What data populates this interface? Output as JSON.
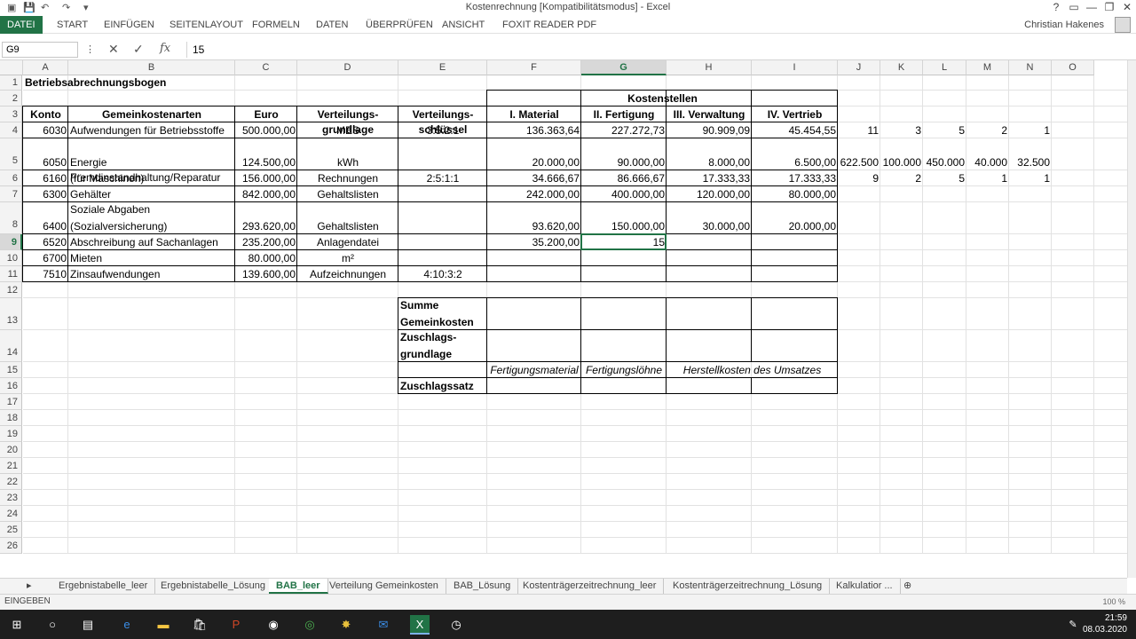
{
  "window": {
    "title": "Kostenrechnung  [Kompatibilitätsmodus] - Excel",
    "help": "?",
    "minimize": "—",
    "restore": "❐",
    "close": "✕"
  },
  "ribbon": {
    "tabs": [
      "DATEI",
      "START",
      "EINFÜGEN",
      "SEITENLAYOUT",
      "FORMELN",
      "DATEN",
      "ÜBERPRÜFEN",
      "ANSICHT",
      "FOXIT READER PDF"
    ],
    "user": "Christian Hakenes"
  },
  "formula_bar": {
    "name_box": "G9",
    "content": "15",
    "cancel_icon": "✕",
    "enter_icon": "✓",
    "fx_label": "fx"
  },
  "columns": [
    "A",
    "B",
    "C",
    "D",
    "E",
    "F",
    "G",
    "H",
    "I",
    "J",
    "K",
    "L",
    "M",
    "N",
    "O"
  ],
  "rows": [
    "1",
    "2",
    "3",
    "4",
    "5",
    "6",
    "7",
    "8",
    "9",
    "10",
    "11",
    "12",
    "13",
    "14",
    "15",
    "16",
    "17",
    "18",
    "19",
    "20",
    "21",
    "22",
    "23",
    "24",
    "25",
    "26"
  ],
  "sheet": {
    "title": "Betriebsabrechnungsbogen",
    "kostenstellen": "Kostenstellen",
    "headers": {
      "konto": "Konto",
      "arten": "Gemeinkostenarten",
      "euro": "Euro",
      "grundlage": "Verteilungs-\ngrundlage",
      "schluessel": "Verteilungs-\nschlüssel",
      "f": "I. Material",
      "g": "II. Fertigung",
      "h": "III. Verwaltung",
      "i": "IV. Vertrieb"
    },
    "r4": {
      "konto": "6030",
      "art": "Aufwendungen für Betriebsstoffe",
      "euro": "500.000,00",
      "grundlage": "MES",
      "schluessel": "3:5:2:1",
      "f": "136.363,64",
      "g": "227.272,73",
      "h": "90.909,09",
      "i": "45.454,55",
      "j": "11",
      "k": "3",
      "l": "5",
      "m": "2",
      "n": "1"
    },
    "r5": {
      "konto": "6050",
      "art": "Energie",
      "euro": "124.500,00",
      "grundlage": "kWh",
      "f": "20.000,00",
      "g": "90.000,00",
      "h": "8.000,00",
      "i": "6.500,00",
      "j": "622.500",
      "k": "100.000",
      "l": "450.000",
      "m": "40.000",
      "n": "32.500"
    },
    "r6": {
      "konto": "6160",
      "art1": "Fremdinstandhaltung/Reparatur",
      "art2": "(für Maschinen)",
      "euro": "156.000,00",
      "grundlage": "Rechnungen",
      "schluessel": "2:5:1:1",
      "f": "34.666,67",
      "g": "86.666,67",
      "h": "17.333,33",
      "i": "17.333,33",
      "j": "9",
      "k": "2",
      "l": "5",
      "m": "1",
      "n": "1"
    },
    "r7": {
      "konto": "6300",
      "art": "Gehälter",
      "euro": "842.000,00",
      "grundlage": "Gehaltslisten",
      "f": "242.000,00",
      "g": "400.000,00",
      "h": "120.000,00",
      "i": "80.000,00"
    },
    "r8": {
      "konto": "6400",
      "art1": "Soziale Abgaben",
      "art2": "(Sozialversicherung)",
      "euro": "293.620,00",
      "grundlage": "Gehaltslisten",
      "f": "93.620,00",
      "g": "150.000,00",
      "h": "30.000,00",
      "i": "20.000,00"
    },
    "r9": {
      "konto": "6520",
      "art": "Abschreibung auf Sachanlagen",
      "euro": "235.200,00",
      "grundlage": "Anlagendatei",
      "f": "35.200,00",
      "g": "15"
    },
    "r10": {
      "konto": "6700",
      "art": "Mieten",
      "euro": "80.000,00",
      "grundlage": "m²"
    },
    "r11": {
      "konto": "7510",
      "art": "Zinsaufwendungen",
      "euro": "139.600,00",
      "grundlage": "Aufzeichnungen",
      "schluessel": "4:10:3:2"
    },
    "r13": {
      "label1": "Summe",
      "label2": "Gemeinkosten"
    },
    "r14": {
      "label1": "Zuschlags-",
      "label2": "grundlage"
    },
    "r15": {
      "f": "Fertigungsmaterial",
      "g": "Fertigungslöhne",
      "hi": "Herstellkosten des Umsatzes"
    },
    "r16": {
      "label": "Zuschlagssatz"
    }
  },
  "sheet_tabs": [
    "Ergebnistabelle_leer",
    "Ergebnistabelle_Lösung",
    "BAB_leer",
    "Verteilung Gemeinkosten",
    "BAB_Lösung",
    "Kostenträgerzeitrechnung_leer",
    "Kostenträgerzeitrechnung_Lösung",
    "Kalkulatior ..."
  ],
  "active_sheet": "BAB_leer",
  "status": {
    "mode": "EINGEBEN",
    "zoom": "100 %"
  },
  "clock": {
    "time": "21:59",
    "date": "08.03.2020"
  },
  "colors": {
    "excel_green": "#217346"
  }
}
